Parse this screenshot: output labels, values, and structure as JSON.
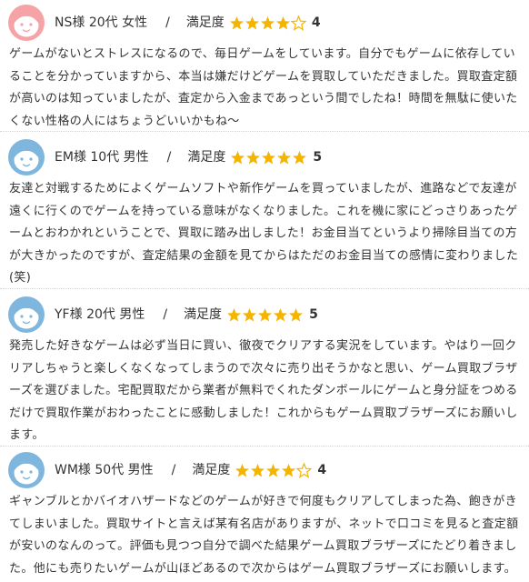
{
  "colors": {
    "star_filled": "#f5b400",
    "star_empty_stroke": "#f5b400",
    "avatar_female": "#f6a3a8",
    "avatar_male": "#7fb6de",
    "text": "#333333"
  },
  "reviews": [
    {
      "name": "NS様",
      "age": "20代",
      "gender": "女性",
      "separator": "/",
      "rating_label": "満足度",
      "rating": 4,
      "rating_max": 5,
      "score_text": "4",
      "avatar_icon": "female-avatar-icon",
      "avatar_color": "#f6a3a8",
      "text": "ゲームがないとストレスになるので、毎日ゲームをしています。自分でもゲームに依存していることを分かっていますから、本当は嫌だけどゲームを買取していただきました。買取査定額が高いのは知っていましたが、査定から入金まであっという間でしたね！時間を無駄に使いたくない性格の人にはちょうどいいかもね〜"
    },
    {
      "name": "EM様",
      "age": "10代",
      "gender": "男性",
      "separator": "/",
      "rating_label": "満足度",
      "rating": 5,
      "rating_max": 5,
      "score_text": "5",
      "avatar_icon": "male-avatar-icon",
      "avatar_color": "#7fb6de",
      "text": "友達と対戦するためによくゲームソフトや新作ゲームを買っていましたが、進路などで友達が遠くに行くのでゲームを持っている意味がなくなりました。これを機に家にどっさりあったゲームとおわかれということで、買取に踏み出しました！お金目当てというより掃除目当ての方が大きかったのですが、査定結果の金額を見てからはただのお金目当ての感情に変わりました(笑)"
    },
    {
      "name": "YF様",
      "age": "20代",
      "gender": "男性",
      "separator": "/",
      "rating_label": "満足度",
      "rating": 5,
      "rating_max": 5,
      "score_text": "5",
      "avatar_icon": "male-avatar-icon",
      "avatar_color": "#7fb6de",
      "text": "発売した好きなゲームは必ず当日に買い、徹夜でクリアする実況をしています。やはり一回クリアしちゃうと楽しくなくなってしまうので次々に売り出そうかなと思い、ゲーム買取ブラザーズを選びました。宅配買取だから業者が無料でくれたダンボールにゲームと身分証をつめるだけで買取作業がおわったことに感動しました！これからもゲーム買取ブラザーズにお願いします。"
    },
    {
      "name": "WM様",
      "age": "50代",
      "gender": "男性",
      "separator": "/",
      "rating_label": "満足度",
      "rating": 4,
      "rating_max": 5,
      "score_text": "4",
      "avatar_icon": "male-avatar-icon",
      "avatar_color": "#7fb6de",
      "text": "ギャンブルとかバイオハザードなどのゲームが好きで何度もクリアしてしまった為、飽きがきてしまいました。買取サイトと言えば某有名店がありますが、ネットで口コミを見ると査定額が安いのなんのって。評価も見つつ自分で調べた結果ゲーム買取ブラザーズにたどり着きました。他にも売りたいゲームが山ほどあるので次からはゲーム買取ブラザーズにお願いします。"
    }
  ]
}
